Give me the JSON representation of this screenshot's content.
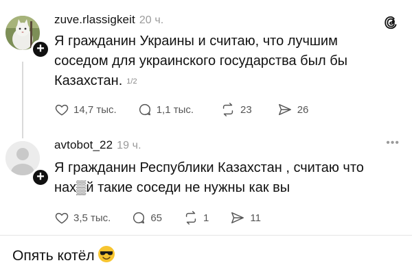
{
  "posts": [
    {
      "username": "zuve.rlassigkeit",
      "time": "20 ч.",
      "text_lines": [
        "Я гражданин Украины и считаю, что лучшим",
        "соседом для украинского государства был бы",
        "Казахстан."
      ],
      "pager": "1/2",
      "avatar_icon": "cat-photo-avatar",
      "actions": {
        "likes": "14,7 тыс.",
        "replies": "1,1 тыс.",
        "reposts": "23",
        "shares": "26"
      }
    },
    {
      "username": "avtobot_22",
      "time": "19 ч.",
      "text_lines": [
        "Я  гражданин Республики Казахстан , считаю что",
        "нах▒й такие соседи не нужны как вы"
      ],
      "avatar_icon": "default-user-avatar",
      "actions": {
        "likes": "3,5 тыс.",
        "replies": "65",
        "reposts": "1",
        "shares": "11"
      }
    }
  ],
  "caption": {
    "text": "Опять котёл",
    "emoji": "smiling-face-with-sunglasses"
  },
  "icons": [
    "threads-logo-icon",
    "heart-icon",
    "comment-icon",
    "repost-icon",
    "share-icon",
    "more-icon"
  ],
  "colors": {
    "text": "#111111",
    "muted": "#9a9a9a",
    "line": "#dadada",
    "background": "#ffffff"
  }
}
